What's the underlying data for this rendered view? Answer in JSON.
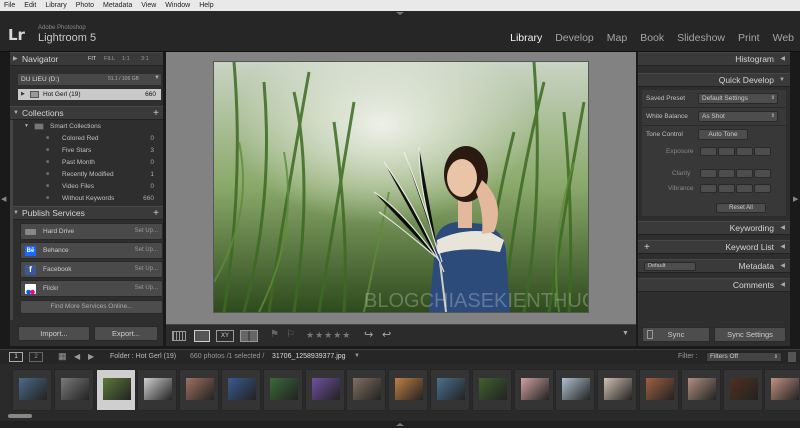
{
  "menu": [
    "File",
    "Edit",
    "Library",
    "Photo",
    "Metadata",
    "View",
    "Window",
    "Help"
  ],
  "app": {
    "logo": "Lr",
    "sub": "Adobe Photoshop",
    "name": "Lightroom 5"
  },
  "modules": [
    "Library",
    "Develop",
    "Map",
    "Book",
    "Slideshow",
    "Print",
    "Web"
  ],
  "left": {
    "navigator": {
      "title": "Navigator",
      "zooms": [
        "FIT",
        "FILL",
        "1:1",
        "3:1"
      ]
    },
    "source": {
      "name": "DU LIEU (D:)",
      "size": "51.1 / 106 GB"
    },
    "folder": {
      "name": "Hot Gerl (19)",
      "count": "660"
    },
    "collections": {
      "title": "Collections",
      "group": "Smart Collections",
      "items": [
        {
          "label": "Colored Red",
          "count": "0"
        },
        {
          "label": "Five Stars",
          "count": "3"
        },
        {
          "label": "Past Month",
          "count": "0"
        },
        {
          "label": "Recently Modified",
          "count": "1"
        },
        {
          "label": "Video Files",
          "count": "0"
        },
        {
          "label": "Without Keywords",
          "count": "660"
        }
      ]
    },
    "publish": {
      "title": "Publish Services",
      "setup": "Set Up...",
      "services": [
        "Hard Drive",
        "Behance",
        "Facebook",
        "Flickr"
      ],
      "find_more": "Find More Services Online..."
    },
    "import": "Import...",
    "export": "Export..."
  },
  "right": {
    "histogram": "Histogram",
    "quick_develop": {
      "title": "Quick Develop",
      "saved_preset": {
        "label": "Saved Preset",
        "value": "Default Settings"
      },
      "white_balance": {
        "label": "White Balance",
        "value": "As Shot"
      },
      "tone_control": {
        "label": "Tone Control",
        "auto": "Auto Tone"
      },
      "sliders": [
        "Exposure",
        "Clarity",
        "Vibrance"
      ],
      "reset": "Reset All"
    },
    "keywording": "Keywording",
    "keyword_list": "Keyword List",
    "metadata": {
      "title": "Metadata",
      "preset": "Default"
    },
    "comments": "Comments",
    "sync": "Sync",
    "sync_settings": "Sync Settings"
  },
  "toolbar": {
    "stars": "★★★★★",
    "xy": "XY"
  },
  "watermark": "BLOGCHIASEKIENTHUC.COM",
  "filmbar": {
    "pages": [
      "1",
      "2"
    ],
    "folder": "Folder : Hot Gerl (19)",
    "photos": "660 photos /1 selected /",
    "filename": "31706_1258939377.jpg",
    "filter_label": "Filter :",
    "filter_value": "Filters Off"
  },
  "thumb_colors": [
    "#4a6a8a",
    "#7a7a7a",
    "#5c7a3a",
    "#cfcfcf",
    "#a07060",
    "#3a5a90",
    "#3a6a3a",
    "#7050a0",
    "#807060",
    "#c08040",
    "#4a7090",
    "#406030",
    "#d0a0a0",
    "#b0c0d0",
    "#d0c0b0",
    "#a06040",
    "#b09080",
    "#503020",
    "#c09080"
  ]
}
